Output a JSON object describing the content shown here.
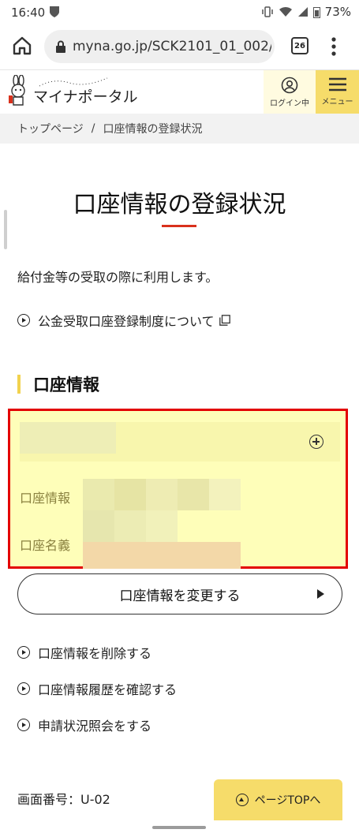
{
  "status_bar": {
    "time": "16:40",
    "battery": "73%"
  },
  "browser": {
    "url": "myna.go.jp/SCK2101_01_002/S",
    "tab_count": "26"
  },
  "header": {
    "logo_text": "マイナポータル",
    "login_label": "ログイン中",
    "menu_label": "メニュー"
  },
  "breadcrumb": {
    "home": "トップページ",
    "separator": "/",
    "current": "口座情報の登録状況"
  },
  "main": {
    "title": "口座情報の登録状況",
    "description": "給付金等の受取の際に利用します。",
    "system_link": "公金受取口座登録制度について",
    "section_heading": "口座情報",
    "account": {
      "label_info": "口座情報",
      "label_name": "口座名義"
    },
    "change_button": "口座情報を変更する",
    "actions": [
      "口座情報を削除する",
      "口座情報履歴を確認する",
      "申請状況照会をする"
    ],
    "screen_number": "画面番号：U-02",
    "page_top": "ページTOPへ"
  },
  "colors": {
    "accent_yellow": "#f6dc6a",
    "highlight_border": "#e30000",
    "title_underline": "#d9311c",
    "account_bg": "#fefeb9"
  },
  "icons": [
    "home-icon",
    "lock-icon",
    "tabs-icon",
    "menu-dots-icon",
    "user-icon",
    "hamburger-icon",
    "play-circle-icon",
    "external-link-icon",
    "plus-circle-icon",
    "arrow-right-icon",
    "arrow-up-circle-icon"
  ]
}
